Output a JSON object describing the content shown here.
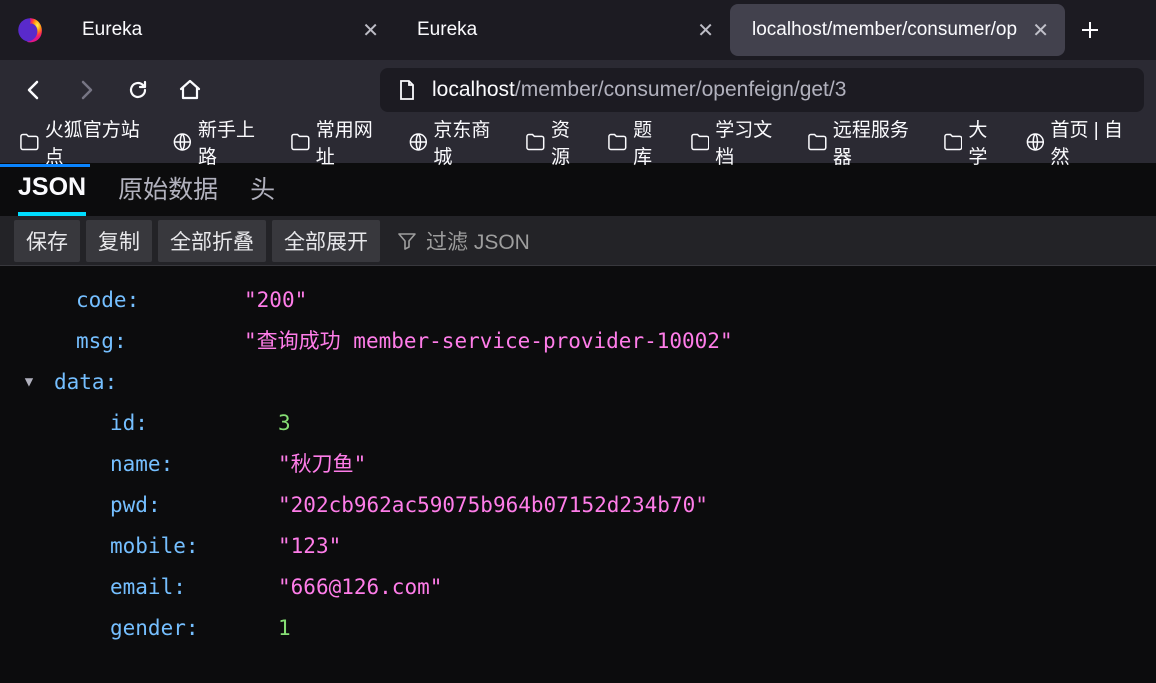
{
  "tabs": [
    {
      "title": "Eureka"
    },
    {
      "title": "Eureka"
    },
    {
      "title": "localhost/member/consumer/op",
      "active": true
    }
  ],
  "url": {
    "host": "localhost",
    "path": "/member/consumer/openfeign/get/3"
  },
  "bookmarks": [
    {
      "label": "火狐官方站点",
      "icon": "folder"
    },
    {
      "label": "新手上路",
      "icon": "globe"
    },
    {
      "label": "常用网址",
      "icon": "folder"
    },
    {
      "label": "京东商城",
      "icon": "globe"
    },
    {
      "label": "资源",
      "icon": "folder"
    },
    {
      "label": "题库",
      "icon": "folder"
    },
    {
      "label": "学习文档",
      "icon": "folder"
    },
    {
      "label": "远程服务器",
      "icon": "folder"
    },
    {
      "label": "大学",
      "icon": "folder"
    },
    {
      "label": "首页 | 自然",
      "icon": "globe"
    }
  ],
  "jsonViewer": {
    "tabs": {
      "json": "JSON",
      "raw": "原始数据",
      "headers": "头"
    },
    "buttons": {
      "save": "保存",
      "copy": "复制",
      "collapseAll": "全部折叠",
      "expandAll": "全部展开"
    },
    "filterPlaceholder": "过滤 JSON"
  },
  "jsonPayload": {
    "code": "200",
    "msg": "查询成功 member-service-provider-10002",
    "data": {
      "id": 3,
      "name": "秋刀鱼",
      "pwd": "202cb962ac59075b964b07152d234b70",
      "mobile": "123",
      "email": "666@126.com",
      "gender": 1
    }
  },
  "keys": {
    "code": "code",
    "msg": "msg",
    "data": "data",
    "id": "id",
    "name": "name",
    "pwd": "pwd",
    "mobile": "mobile",
    "email": "email",
    "gender": "gender"
  }
}
